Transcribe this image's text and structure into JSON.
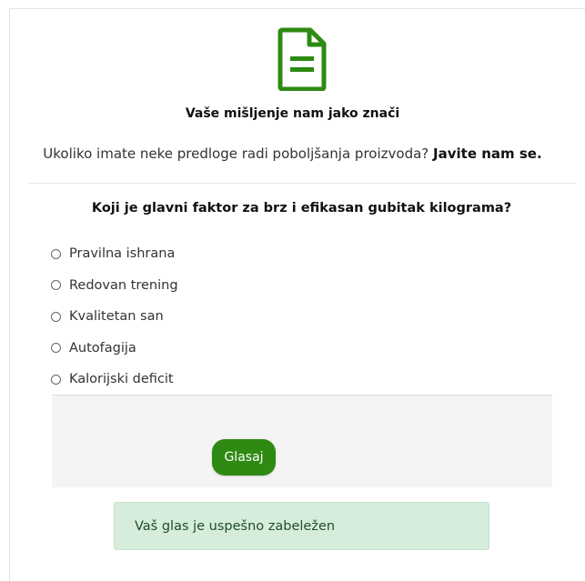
{
  "header": {
    "icon": "document-icon",
    "title": "Vaše mišljenje nam jako znači",
    "subtitle_text": "Ukoliko imate neke predloge radi poboljšanja proizvoda?",
    "subtitle_link": "Javite nam se."
  },
  "poll": {
    "question": "Koji je glavni faktor za brz i efikasan gubitak kilograma?",
    "options": [
      {
        "label": "Pravilna ishrana"
      },
      {
        "label": "Redovan trening"
      },
      {
        "label": "Kvalitetan san"
      },
      {
        "label": "Autofagija"
      },
      {
        "label": "Kalorijski deficit"
      }
    ],
    "vote_label": "Glasaj",
    "success_message": "Vaš glas je uspešno zabeležen"
  },
  "colors": {
    "brand_green": "#2e8a12",
    "alert_bg": "#d7eddb"
  }
}
